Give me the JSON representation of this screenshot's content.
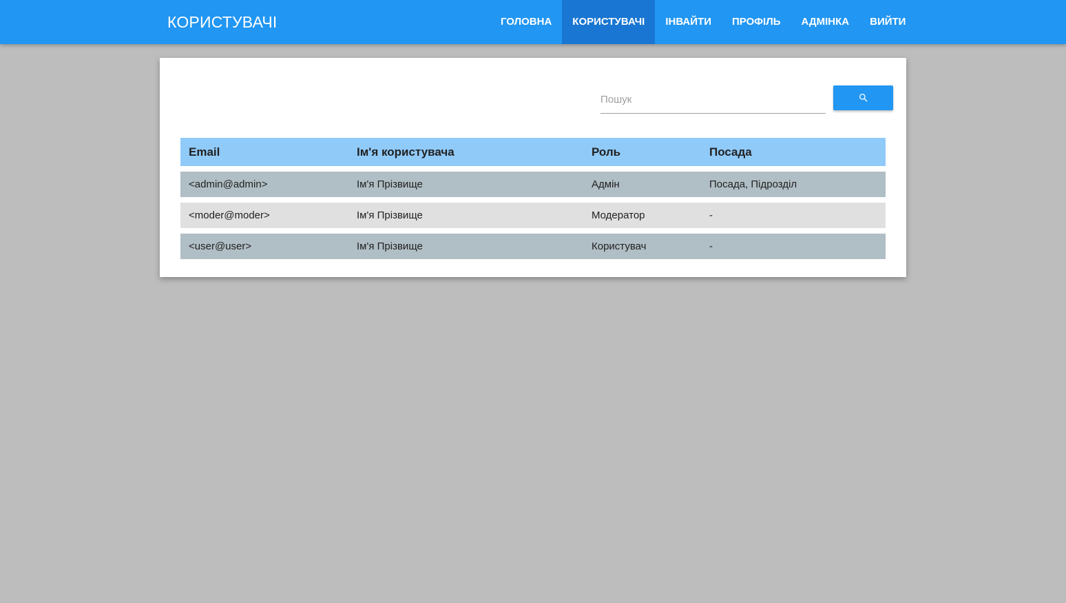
{
  "app": {
    "title": "КОРИСТУВАЧІ"
  },
  "nav": {
    "items": [
      {
        "label": "ГОЛОВНА",
        "active": false
      },
      {
        "label": "КОРИСТУВАЧІ",
        "active": true
      },
      {
        "label": "ІНВАЙТИ",
        "active": false
      },
      {
        "label": "ПРОФІЛЬ",
        "active": false
      },
      {
        "label": "АДМІНКА",
        "active": false
      },
      {
        "label": "ВИЙТИ",
        "active": false
      }
    ]
  },
  "search": {
    "placeholder": "Пошук",
    "value": "",
    "button_icon": "search-icon"
  },
  "table": {
    "headers": [
      "Email",
      "Ім'я користувача",
      "Роль",
      "Посада"
    ],
    "rows": [
      [
        "<admin@admin>",
        "Ім'я Прізвище",
        "Адмін",
        "Посада, Підрозділ"
      ],
      [
        "<moder@moder>",
        "Ім'я Прізвище",
        "Модератор",
        "-"
      ],
      [
        "<user@user>",
        "Ім'я Прізвище",
        "Користувач",
        "-"
      ]
    ]
  },
  "colors": {
    "primary": "#2196f3",
    "primary_dark": "#1976d2",
    "header_row": "#90caf9",
    "row_odd": "#b0bec5",
    "row_even": "#e0e0e0",
    "background": "#bdbdbd"
  }
}
